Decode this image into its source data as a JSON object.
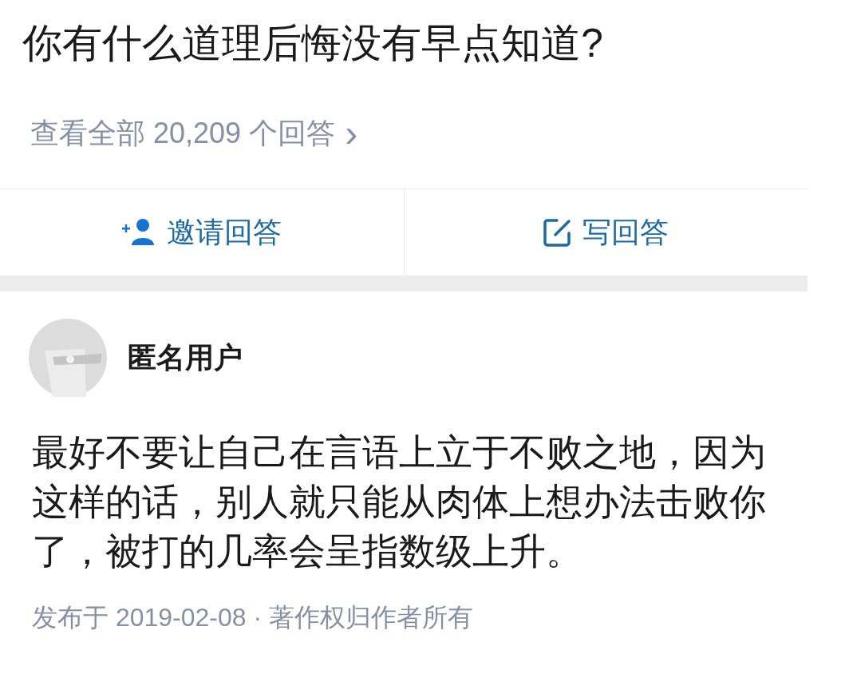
{
  "question": {
    "title": "你有什么道理后悔没有早点知道?"
  },
  "view_all": {
    "label": "查看全部 20,209 个回答",
    "chevron": "›"
  },
  "actions": [
    {
      "kind": "invite",
      "label": "邀请回答"
    },
    {
      "kind": "write",
      "label": "写回答"
    }
  ],
  "answer": {
    "author": "匿名用户",
    "body": "最好不要让自己在言语上立于不败之地，因为这样的话，别人就只能从肉体上想办法击败你了，被打的几率会呈指数级上升。",
    "footer": "发布于 2019-02-08 · 著作权归作者所有"
  }
}
